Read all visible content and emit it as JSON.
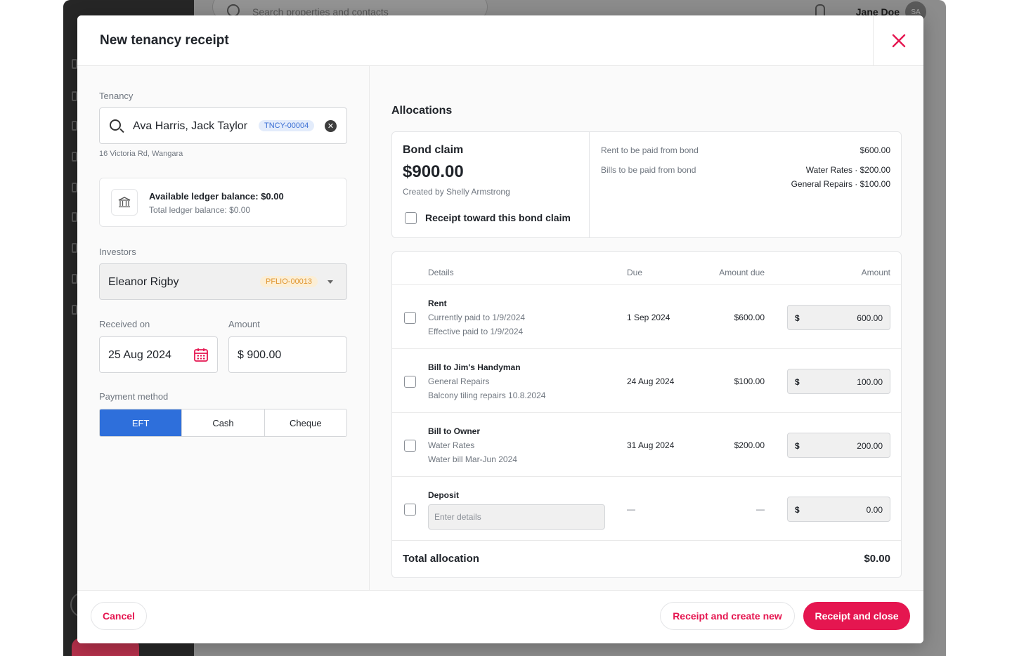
{
  "background": {
    "search_placeholder": "Search properties and contacts",
    "user_name": "Jane Doe",
    "user_initials": "SA"
  },
  "modal": {
    "title": "New tenancy receipt",
    "close_icon": "close-icon"
  },
  "tenancy": {
    "label": "Tenancy",
    "value": "Ava Harris, Jack Taylor",
    "code": "TNCY-00004",
    "address": "16 Victoria Rd, Wangara",
    "available_balance": "Available ledger balance: $0.00",
    "total_balance": "Total ledger balance: $0.00"
  },
  "investors": {
    "label": "Investors",
    "value": "Eleanor Rigby",
    "code": "PFLIO-00013"
  },
  "received_on": {
    "label": "Received on",
    "value": "25 Aug 2024"
  },
  "amount": {
    "label": "Amount",
    "value": "$ 900.00"
  },
  "payment_method": {
    "label": "Payment method",
    "options": [
      "EFT",
      "Cash",
      "Cheque"
    ],
    "selected": "EFT"
  },
  "allocations": {
    "title": "Allocations",
    "bond": {
      "title": "Bond claim",
      "amount": "$900.00",
      "created_by": "Created by Shelly Armstrong",
      "checkbox_label": "Receipt toward this bond claim",
      "rent_label": "Rent to be paid from bond",
      "rent_value": "$600.00",
      "bills_label": "Bills to be paid from bond",
      "bills_line1": "Water Rates · $200.00",
      "bills_line2": "General Repairs · $100.00"
    },
    "columns": {
      "details": "Details",
      "due": "Due",
      "amount_due": "Amount due",
      "amount": "Amount"
    },
    "rows": [
      {
        "title": "Rent",
        "sub1": "Currently paid to 1/9/2024",
        "sub2": "Effective paid to 1/9/2024",
        "due": "1 Sep 2024",
        "amount_due": "$600.00",
        "currency": "$",
        "amount": "600.00"
      },
      {
        "title": "Bill to Jim's Handyman",
        "sub1": "General Repairs",
        "sub2": "Balcony tiling repairs 10.8.2024",
        "due": "24 Aug 2024",
        "amount_due": "$100.00",
        "currency": "$",
        "amount": "100.00"
      },
      {
        "title": "Bill to Owner",
        "sub1": "Water Rates",
        "sub2": "Water bill Mar-Jun 2024",
        "due": "31 Aug 2024",
        "amount_due": "$200.00",
        "currency": "$",
        "amount": "200.00"
      }
    ],
    "deposit": {
      "title": "Deposit",
      "placeholder": "Enter details",
      "due": "—",
      "amount_due": "—",
      "currency": "$",
      "amount": "0.00"
    },
    "total_label": "Total allocation",
    "total_value": "$0.00"
  },
  "footer": {
    "cancel": "Cancel",
    "receipt_create_new": "Receipt and create new",
    "receipt_close": "Receipt and close"
  },
  "colors": {
    "accent": "#e51650",
    "primary_blue": "#2e6fdb"
  }
}
